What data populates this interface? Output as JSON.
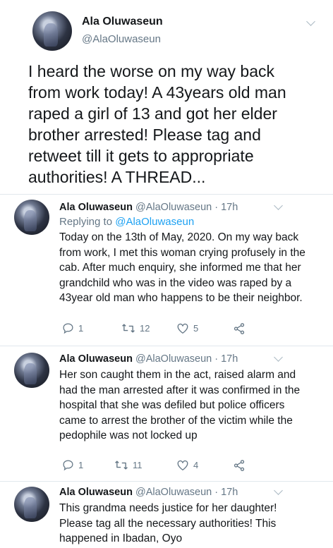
{
  "main_tweet": {
    "name": "Ala Oluwaseun",
    "handle": "@AlaOluwaseun",
    "text": "I heard the worse on my way back from work today! A 43years old man raped a girl of 13 and got her elder brother arrested! Please tag and retweet till it gets to appropriate authorities! A THREAD..."
  },
  "replies": [
    {
      "name": "Ala Oluwaseun",
      "meta": "@AlaOluwaseun · 17h",
      "replying_prefix": "Replying to ",
      "replying_to": "@AlaOluwaseun",
      "text": "Today on the 13th of May, 2020. On my way back from work, I met this woman crying profusely in the cab. After much enquiry, she informed me that her grandchild who was in the video was raped by a 43year old man who happens to be their neighbor.",
      "replies": "1",
      "retweets": "12",
      "likes": "5"
    },
    {
      "name": "Ala Oluwaseun",
      "meta": "@AlaOluwaseun · 17h",
      "text": "Her son caught them in the act, raised alarm and had the man arrested after it was confirmed in the hospital that she was defiled but police officers came to arrest the brother of the victim while the pedophile was not locked up",
      "replies": "1",
      "retweets": "11",
      "likes": "4"
    },
    {
      "name": "Ala Oluwaseun",
      "meta": "@AlaOluwaseun · 17h",
      "text": "This grandma needs justice for her daughter! Please tag all the necessary authorities! This happened in Ibadan, Oyo"
    }
  ]
}
